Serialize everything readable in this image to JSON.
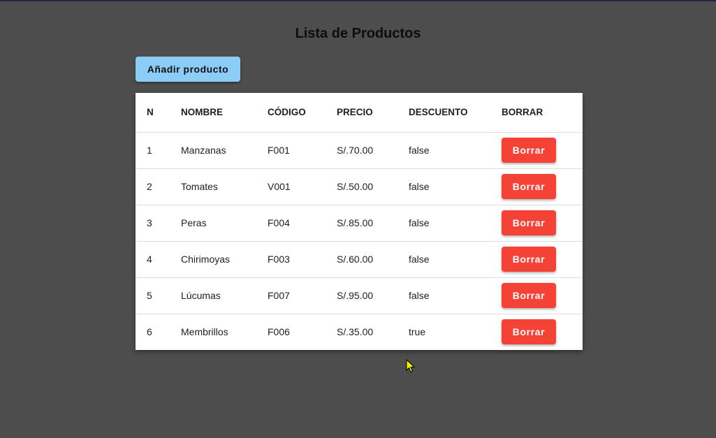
{
  "page": {
    "title": "Lista de Productos",
    "add_button_label": "Añadir producto"
  },
  "table": {
    "headers": [
      "N",
      "NOMBRE",
      "CÓDIGO",
      "PRECIO",
      "DESCUENTO",
      "BORRAR"
    ],
    "rows": [
      {
        "n": "1",
        "nombre": "Manzanas",
        "codigo": "F001",
        "precio": "S/.70.00",
        "descuento": "false",
        "borrar": "Borrar"
      },
      {
        "n": "2",
        "nombre": "Tomates",
        "codigo": "V001",
        "precio": "S/.50.00",
        "descuento": "false",
        "borrar": "Borrar"
      },
      {
        "n": "3",
        "nombre": "Peras",
        "codigo": "F004",
        "precio": "S/.85.00",
        "descuento": "false",
        "borrar": "Borrar"
      },
      {
        "n": "4",
        "nombre": "Chirimoyas",
        "codigo": "F003",
        "precio": "S/.60.00",
        "descuento": "false",
        "borrar": "Borrar"
      },
      {
        "n": "5",
        "nombre": "Lúcumas",
        "codigo": "F007",
        "precio": "S/.95.00",
        "descuento": "false",
        "borrar": "Borrar"
      },
      {
        "n": "6",
        "nombre": "Membrillos",
        "codigo": "F006",
        "precio": "S/.35.00",
        "descuento": "true",
        "borrar": "Borrar"
      }
    ]
  },
  "colors": {
    "background": "#4d4d4d",
    "add_button": "#8ccdf7",
    "delete_button": "#f44336"
  },
  "icons": {
    "cursor": "mouse-pointer-icon"
  }
}
